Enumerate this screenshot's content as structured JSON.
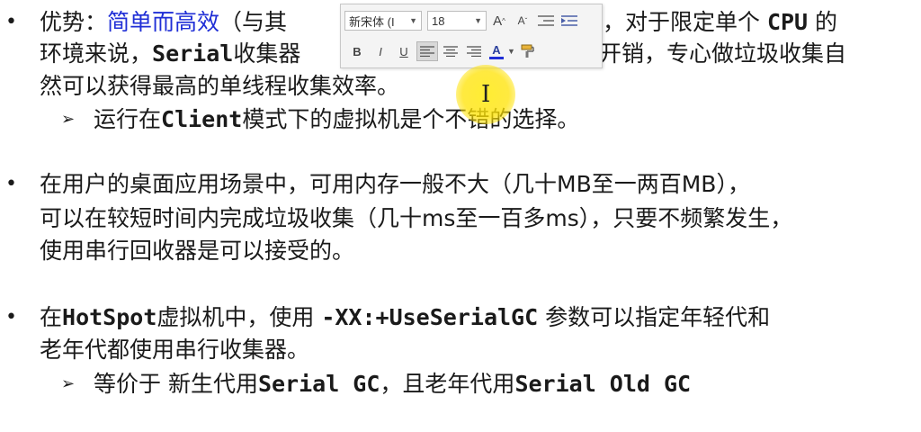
{
  "bullets": [
    {
      "lines": [
        {
          "prefix": "优势：",
          "highlight": "简单而高效",
          "rest_a": "（与其",
          "rest_b": "，对于限定单个 ",
          "mono": "CPU",
          "rest_c": " 的"
        },
        {
          "a": "环境来说，",
          "mono": "Serial",
          "b": "收集器",
          "c": "开销，专心做垃圾收集自"
        },
        {
          "a": "然可以获得最高的单线程收集效率。"
        }
      ],
      "sub": {
        "a": "运行在",
        "mono": "Client",
        "b": "模式下的虚拟机是个不错的选择。"
      }
    },
    {
      "lines": [
        {
          "a": "在用户的桌面应用场景中，可用内存一般不大（几十MB至一两百MB），"
        },
        {
          "a": "可以在较短时间内完成垃圾收集（几十ms至一百多ms），只要不频繁发生，"
        },
        {
          "a": "使用串行回收器是可以接受的。"
        }
      ]
    },
    {
      "lines": [
        {
          "a": "在",
          "mono": "HotSpot",
          "b": "虚拟机中，使用 ",
          "mono2": "-XX:+UseSerialGC",
          "c": " 参数可以指定年轻代和"
        },
        {
          "a": "老年代都使用串行收集器。"
        }
      ],
      "sub": {
        "a": "等价于 新生代用",
        "mono": "Serial GC",
        "b": "，且老年代用",
        "mono2": "Serial Old GC"
      }
    }
  ],
  "bullet_char": "•",
  "sub_char": "➢",
  "toolbar": {
    "font_name": "新宋体 (I",
    "font_size": "18",
    "grow_font": "A",
    "shrink_font": "A",
    "bold": "B",
    "italic": "I",
    "underline": "U",
    "font_color": "A"
  },
  "colors": {
    "highlight": "#1f2ed6",
    "text": "#1a1a1a",
    "toolbar_bg": "#f4f4f4",
    "cursor_halo": "#ffe600"
  }
}
